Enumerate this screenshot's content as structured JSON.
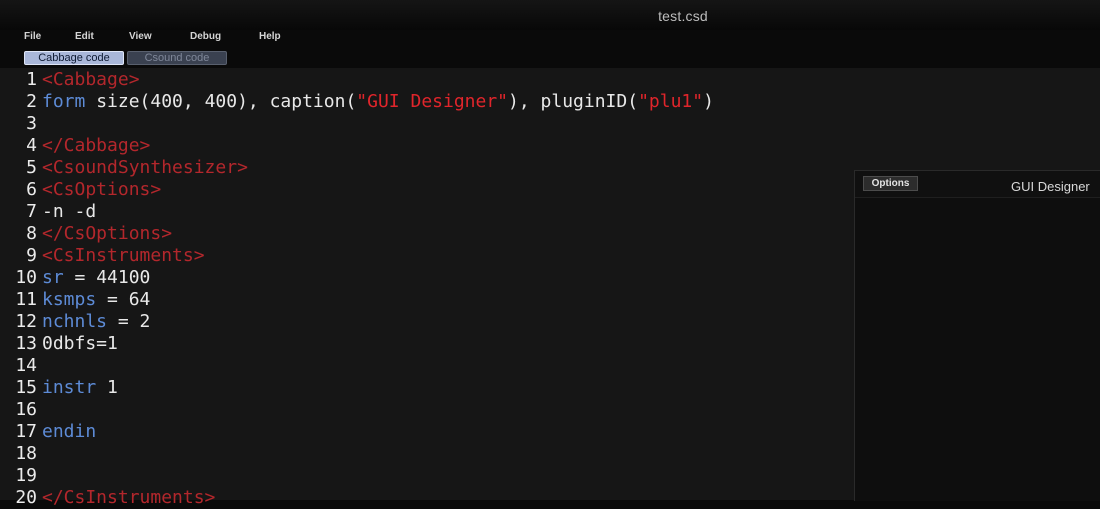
{
  "window": {
    "title": "test.csd"
  },
  "menu": {
    "items": [
      "File",
      "Edit",
      "View",
      "Debug",
      "Help"
    ]
  },
  "tabs": {
    "cabbage": "Cabbage code",
    "csound": "Csound code"
  },
  "designer": {
    "options_label": "Options",
    "title": "GUI Designer"
  },
  "editor": {
    "lines": [
      {
        "n": "1",
        "parts": [
          {
            "t": "<Cabbage>",
            "c": "tag"
          }
        ]
      },
      {
        "n": "2",
        "parts": [
          {
            "t": "form",
            "c": "kw"
          },
          {
            "t": " size(400, 400), caption(",
            "c": "txt"
          },
          {
            "t": "\"GUI Designer\"",
            "c": "str"
          },
          {
            "t": "), pluginID(",
            "c": "txt"
          },
          {
            "t": "\"plu1\"",
            "c": "str"
          },
          {
            "t": ")",
            "c": "txt"
          }
        ]
      },
      {
        "n": "3",
        "parts": []
      },
      {
        "n": "4",
        "parts": [
          {
            "t": "</Cabbage>",
            "c": "tag"
          }
        ]
      },
      {
        "n": "5",
        "parts": [
          {
            "t": "<CsoundSynthesizer>",
            "c": "tag"
          }
        ]
      },
      {
        "n": "6",
        "parts": [
          {
            "t": "<CsOptions>",
            "c": "tag"
          }
        ]
      },
      {
        "n": "7",
        "parts": [
          {
            "t": "-n -d",
            "c": "txt"
          }
        ]
      },
      {
        "n": "8",
        "parts": [
          {
            "t": "</CsOptions>",
            "c": "tag"
          }
        ]
      },
      {
        "n": "9",
        "parts": [
          {
            "t": "<CsInstruments>",
            "c": "tag"
          }
        ]
      },
      {
        "n": "10",
        "parts": [
          {
            "t": "sr",
            "c": "kw"
          },
          {
            "t": " = 44100",
            "c": "txt"
          }
        ]
      },
      {
        "n": "11",
        "parts": [
          {
            "t": "ksmps",
            "c": "kw"
          },
          {
            "t": " = 64",
            "c": "txt"
          }
        ]
      },
      {
        "n": "12",
        "parts": [
          {
            "t": "nchnls",
            "c": "kw"
          },
          {
            "t": " = 2",
            "c": "txt"
          }
        ]
      },
      {
        "n": "13",
        "parts": [
          {
            "t": "0dbfs=1",
            "c": "txt"
          }
        ]
      },
      {
        "n": "14",
        "parts": []
      },
      {
        "n": "15",
        "parts": [
          {
            "t": "instr",
            "c": "kw"
          },
          {
            "t": " 1",
            "c": "txt"
          }
        ]
      },
      {
        "n": "16",
        "parts": []
      },
      {
        "n": "17",
        "parts": [
          {
            "t": "endin",
            "c": "kw"
          }
        ]
      },
      {
        "n": "18",
        "parts": []
      },
      {
        "n": "19",
        "parts": []
      },
      {
        "n": "20",
        "parts": [
          {
            "t": "</CsInstruments>",
            "c": "tag"
          }
        ]
      }
    ]
  }
}
